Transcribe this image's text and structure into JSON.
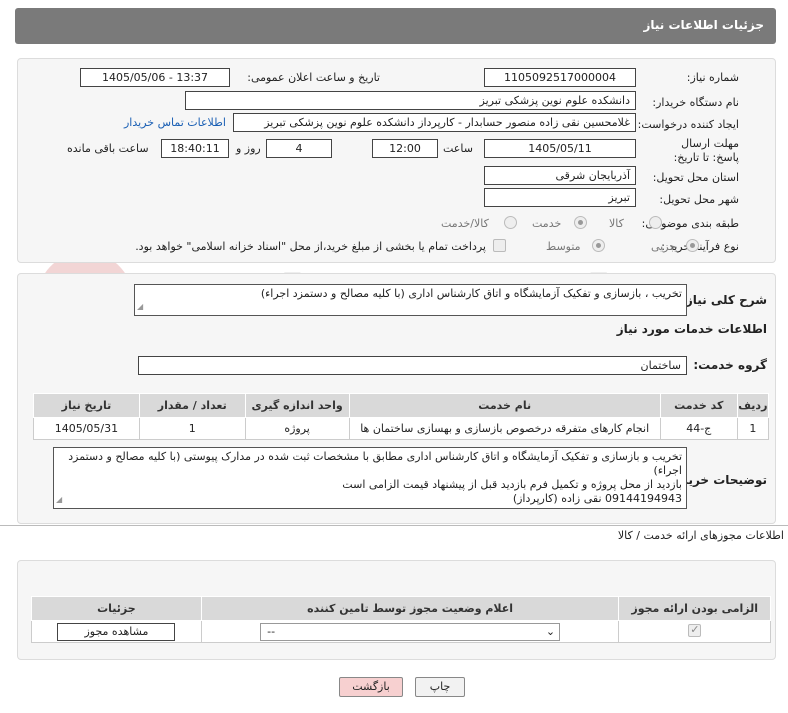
{
  "header": {
    "title": "جزئیات اطلاعات نیاز"
  },
  "form": {
    "need_number_label": "شماره نیاز:",
    "need_number": "1105092517000004",
    "announce_label": "تاریخ و ساعت اعلان عمومی:",
    "announce_value": "1405/05/06 - 13:37",
    "buyer_org_label": "نام دستگاه خریدار:",
    "buyer_org": "دانشکده علوم نوین پزشکی  تبریز",
    "creator_label": "ایجاد کننده درخواست:",
    "creator": "غلامحسین نقی زاده منصور حسابدار - کارپرداز دانشکده علوم نوین پزشکی  تبریز",
    "contact_link": "اطلاعات تماس خریدار",
    "deadline_label": "مهلت ارسال پاسخ: تا تاریخ:",
    "deadline_date": "1405/05/11",
    "time_label": "ساعت",
    "deadline_time": "12:00",
    "days_value": "4",
    "days_label": "روز و",
    "remaining_time": "18:40:11",
    "remaining_label": "ساعت باقی مانده",
    "province_label": "استان محل تحویل:",
    "province": "آذربایجان شرقی",
    "city_label": "شهر محل تحویل:",
    "city": "تبریز",
    "category_label": "طبقه بندی موضوعی:",
    "category_options": [
      "کالا",
      "خدمت",
      "کالا/خدمت"
    ],
    "category_selected": "خدمت",
    "process_label": "نوع فرآیند خرید :",
    "process_options": [
      "جزیی",
      "متوسط"
    ],
    "process_selected": "جزیی",
    "payment_note": "پرداخت تمام یا بخشی از مبلغ خرید،از محل \"اسناد خزانه اسلامی\" خواهد بود."
  },
  "need": {
    "summary_label": "شرح کلی نیاز:",
    "summary": "تخریب ، بازسازی و تفکیک آزمایشگاه و اتاق کارشناس اداری (با کلیه مصالح و دستمزد اجراء)",
    "services_title": "اطلاعات خدمات مورد نیاز",
    "service_group_label": "گروه خدمت:",
    "service_group": "ساختمان",
    "table_headers": [
      "ردیف",
      "کد خدمت",
      "نام خدمت",
      "واحد اندازه گیری",
      "تعداد / مقدار",
      "تاریخ نیاز"
    ],
    "table_rows": [
      [
        "1",
        "ج-44",
        "انجام کارهای متفرقه درخصوص بازسازی و بهسازی ساختمان ها",
        "پروژه",
        "1",
        "1405/05/31"
      ]
    ],
    "buyer_notes_label": "توضیحات خریدار:",
    "buyer_notes": [
      "تخریب و بازسازی و تفکیک آزمایشگاه و اتاق کارشناس اداری مطابق با مشخصات ثبت شده در مدارک پیوستی (با کلیه مصالح و دستمزد اجراء)",
      "بازدید از محل پروژه و تکمیل فرم بازدید قبل از پیشنهاد قیمت الزامی است",
      "09144194943 نقی زاده (کارپرداز)"
    ]
  },
  "permits": {
    "section_title": "اطلاعات مجوزهای ارائه خدمت / کالا",
    "headers": [
      "الزامی بودن ارائه مجوز",
      "اعلام وضعیت مجوز توسط تامین کننده",
      "جزئیات"
    ],
    "select_value": "--",
    "view_button": "مشاهده مجوز"
  },
  "actions": {
    "print": "چاپ",
    "back": "بازگشت"
  },
  "watermark": {
    "text": "AriaTender.net"
  },
  "colors": {
    "header": "#7a7a7a",
    "link": "#1a5fb4",
    "back_button": "#f7d0d0"
  }
}
